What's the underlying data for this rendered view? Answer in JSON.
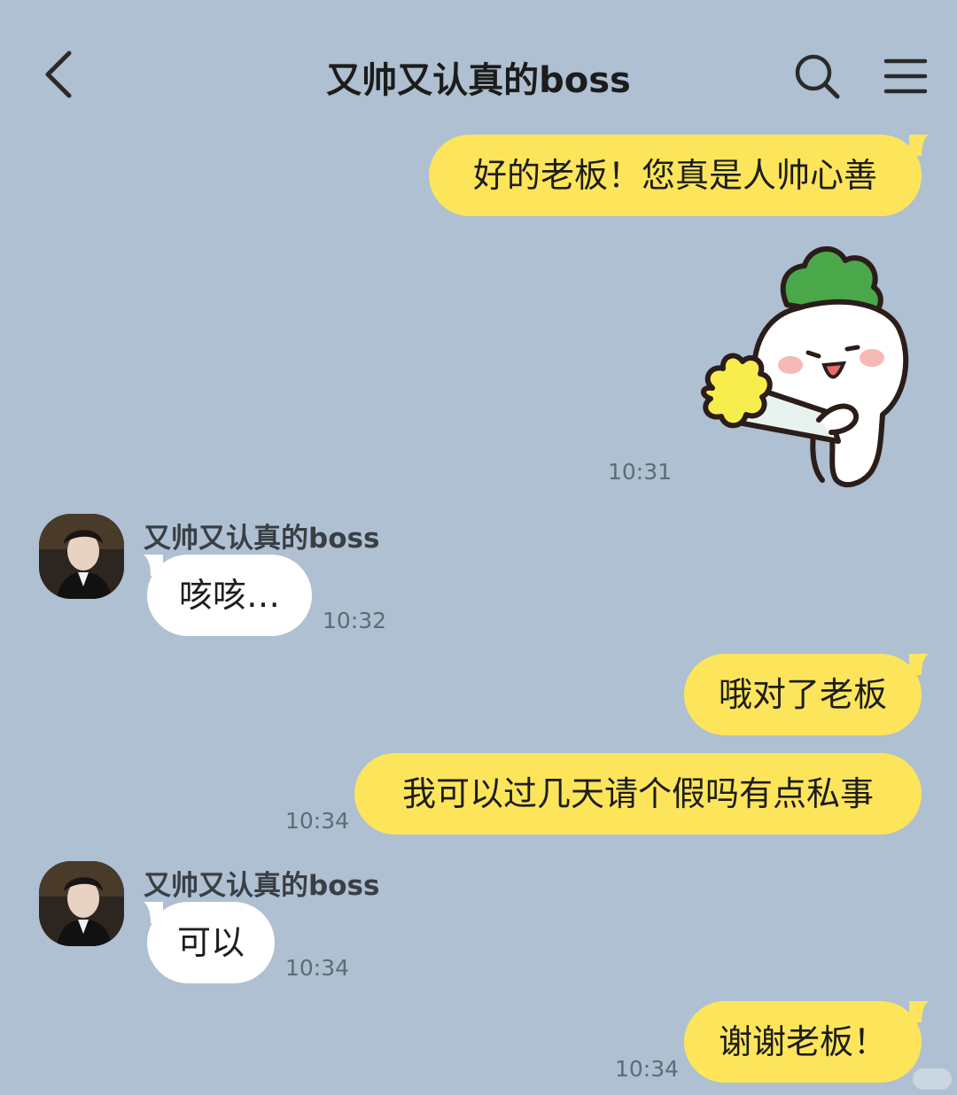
{
  "header": {
    "title": "又帅又认真的boss",
    "back_icon": "chevron-left-icon",
    "search_icon": "search-icon",
    "menu_icon": "hamburger-menu-icon"
  },
  "colors": {
    "background": "#aec0d1",
    "outgoing_bubble": "#fde55b",
    "incoming_bubble": "#ffffff"
  },
  "messages": [
    {
      "direction": "out",
      "text": "好的老板！您真是人帅心善"
    },
    {
      "direction": "out",
      "sticker": "radish-holding-bouquet-sticker",
      "time": "10:31"
    },
    {
      "direction": "in",
      "sender": "又帅又认真的boss",
      "text": "咳咳…",
      "time": "10:32"
    },
    {
      "direction": "out",
      "text": "哦对了老板"
    },
    {
      "direction": "out",
      "text": "我可以过几天请个假吗有点私事",
      "time": "10:34"
    },
    {
      "direction": "in",
      "sender": "又帅又认真的boss",
      "text": "可以",
      "time": "10:34"
    },
    {
      "direction": "out",
      "text": "谢谢老板！",
      "time": "10:34"
    }
  ]
}
